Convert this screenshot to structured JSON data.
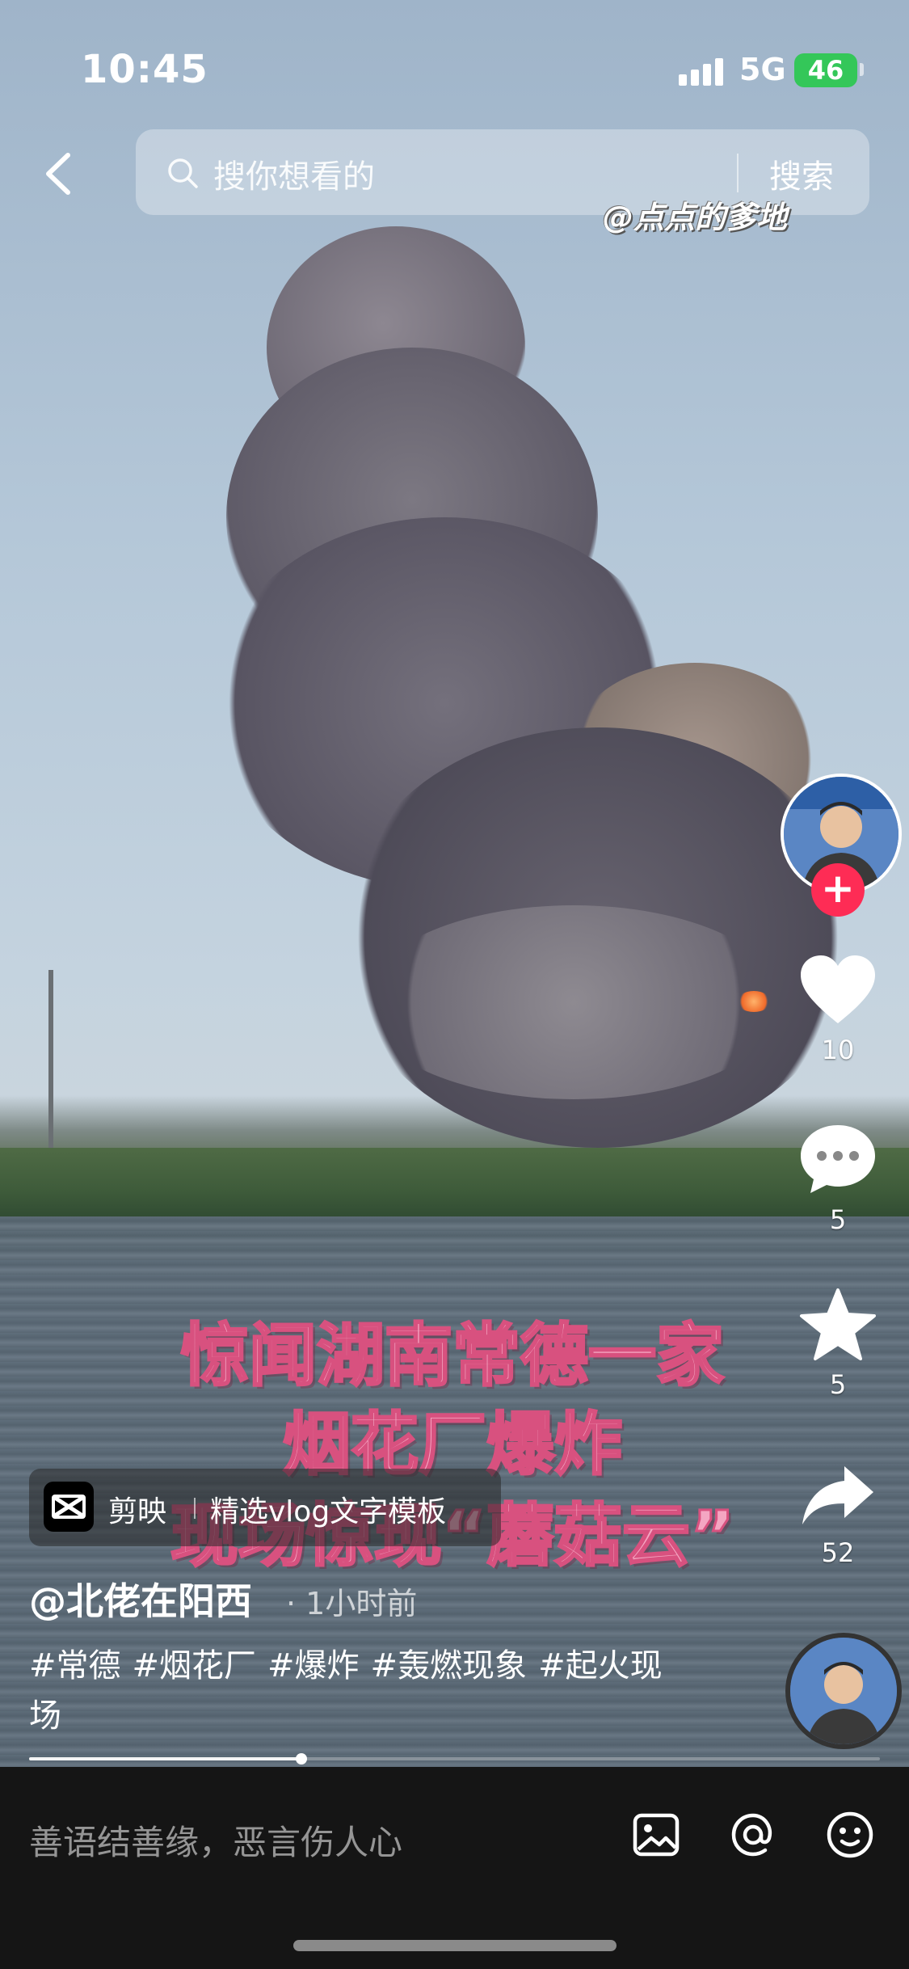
{
  "status_bar": {
    "time": "10:45",
    "network": "5G",
    "battery": "46"
  },
  "search": {
    "placeholder": "搜你想看的",
    "button_label": "搜索"
  },
  "video": {
    "watermark": "@点点的爹地",
    "headline_lines": [
      "惊闻湖南常德一家",
      "烟花厂爆炸",
      "现场惊现“蘑菇云”"
    ]
  },
  "actions": {
    "likes": "10",
    "comments": "5",
    "favorites": "5",
    "shares": "52"
  },
  "template_badge": {
    "app": "剪映",
    "description": "精选vlog文字模板"
  },
  "post": {
    "author": "@北佬在阳西",
    "time": "· 1小时前",
    "tags": [
      "#常德",
      "#烟花厂",
      "#爆炸",
      "#轰燃现象",
      "#起火现场"
    ]
  },
  "playback": {
    "progress": 0.32
  },
  "comment_bar": {
    "placeholder": "善语结善缘，恶言伤人心"
  }
}
